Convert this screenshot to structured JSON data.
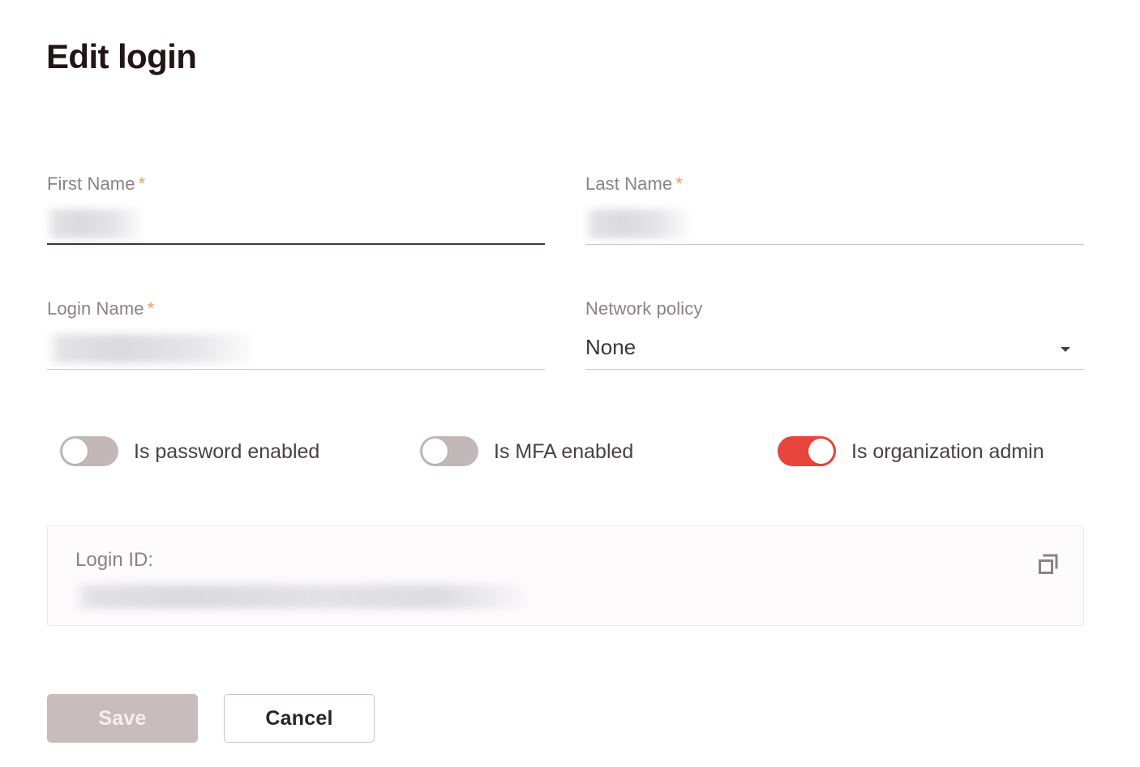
{
  "page": {
    "title": "Edit login"
  },
  "form": {
    "fields": [
      {
        "label": "First Name",
        "required_marker": "*",
        "value": "",
        "redacted": true,
        "focused": true
      },
      {
        "label": "Last Name",
        "required_marker": "*",
        "value": "",
        "redacted": true,
        "focused": false
      },
      {
        "label": "Login Name",
        "required_marker": "*",
        "value": "",
        "redacted": true,
        "focused": false
      },
      {
        "label": "Network policy",
        "required_marker": "",
        "value": "None",
        "redacted": false,
        "focused": false
      }
    ]
  },
  "toggles": [
    {
      "label": "Is password enabled",
      "state": "off"
    },
    {
      "label": "Is MFA enabled",
      "state": "off"
    },
    {
      "label": "Is organization admin",
      "state": "on"
    }
  ],
  "login_id_panel": {
    "label": "Login ID:",
    "value": "",
    "copy_icon": "copy-icon"
  },
  "actions": {
    "save_label": "Save",
    "save_disabled": true,
    "cancel_label": "Cancel"
  },
  "colors": {
    "accent_red": "#e8453c",
    "required_star": "#ef9b63",
    "label_gray": "#8d8185",
    "text_dark": "#3e3436",
    "toggle_off": "#c3b8b9",
    "save_disabled_bg": "#c8bcbe",
    "panel_bg": "#fdfbfc",
    "panel_border": "#f0e9ec"
  }
}
